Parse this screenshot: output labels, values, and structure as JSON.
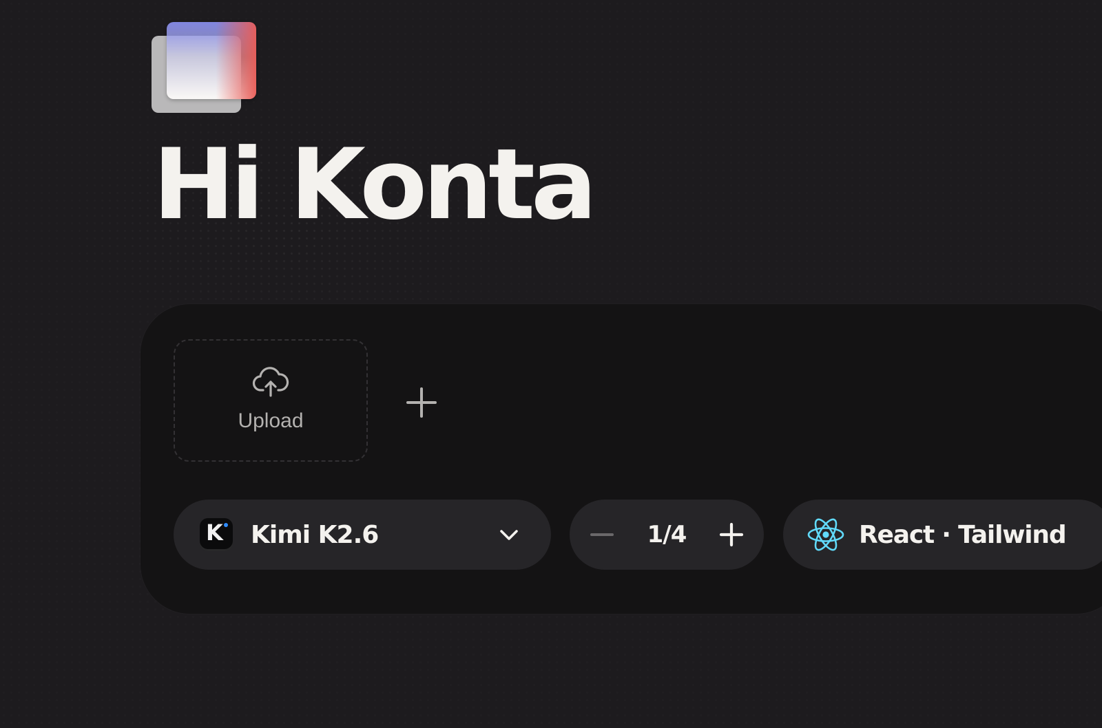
{
  "greeting": "Hi Konta",
  "upload": {
    "label": "Upload",
    "icon": "cloud-upload-icon"
  },
  "add_attachment": {
    "icon": "plus-icon"
  },
  "model_selector": {
    "selected": "Kimi K2.6",
    "icon": "kimi-logo-icon",
    "dropdown_icon": "chevron-down-icon"
  },
  "count_stepper": {
    "value": "1/4",
    "decrement_icon": "minus-icon",
    "increment_icon": "plus-icon"
  },
  "stack_selector": {
    "label": "React · Tailwind",
    "icon": "react-icon",
    "icon_color": "#61dafb"
  },
  "colors": {
    "background": "#1d1b1e",
    "panel": "#141314",
    "pill": "#262528",
    "text": "#f4f2ee",
    "muted_text": "#b4b2b0"
  }
}
